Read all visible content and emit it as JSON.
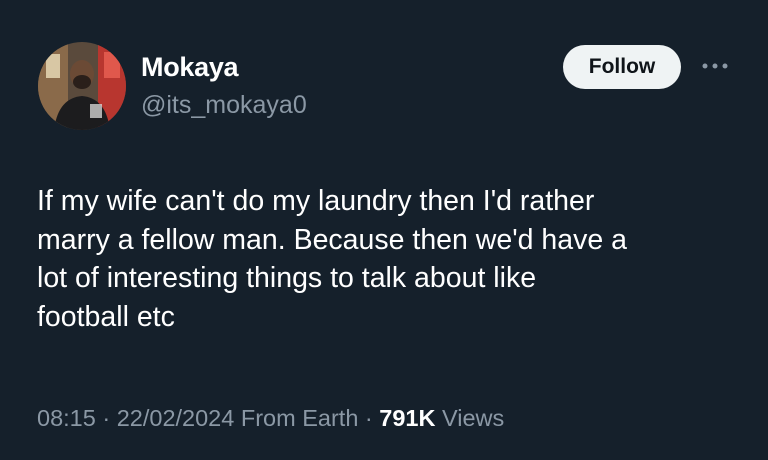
{
  "author": {
    "display_name": "Mokaya",
    "handle": "@its_mokaya0",
    "avatar_icon": "profile-photo"
  },
  "follow_label": "Follow",
  "more_icon": "more-options-icon",
  "tweet": {
    "text": "If my wife can't do my laundry then I'd rather\nmarry a fellow man. Because then we'd have a\nlot of interesting things to talk about like\nfootball etc",
    "time": "08:15",
    "separator": "·",
    "date": "22/02/2024",
    "source": "From Earth",
    "views_count": "791K",
    "views_label": "Views"
  },
  "colors": {
    "background": "#15202b",
    "primary_text": "#ffffff",
    "secondary_text": "#8b98a5",
    "follow_button_bg": "#eff3f4",
    "follow_button_text": "#0f1419"
  }
}
